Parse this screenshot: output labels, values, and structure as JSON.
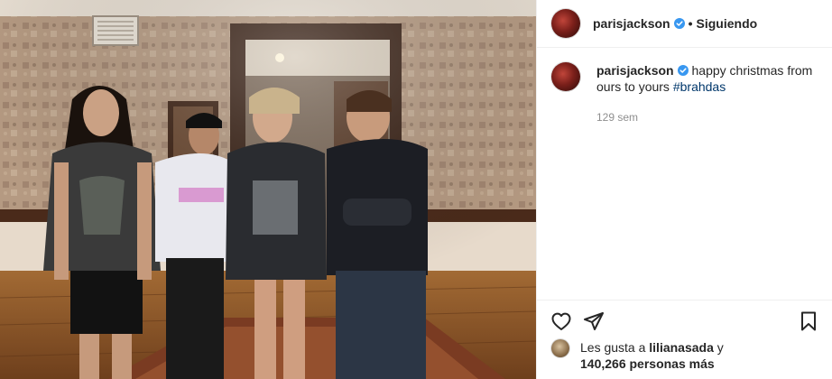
{
  "post": {
    "author": "parisjackson",
    "follow_status": "Siguiendo",
    "separator": "•",
    "caption_text": "happy christmas from ours to yours ",
    "caption_hashtag": "#brahdas",
    "time_ago": "129 sem",
    "likes_prefix": "Les gusta a ",
    "likes_user": "lilianasada",
    "likes_conjunction": " y",
    "likes_count": "140,266 personas más"
  },
  "icons": {
    "verified": "verified-badge-icon",
    "like": "heart-icon",
    "share": "paper-plane-icon",
    "save": "bookmark-icon"
  },
  "colors": {
    "text": "#262626",
    "muted": "#8e8e8e",
    "hashtag": "#00376b",
    "verified": "#3897f0",
    "divider": "#efefef"
  }
}
